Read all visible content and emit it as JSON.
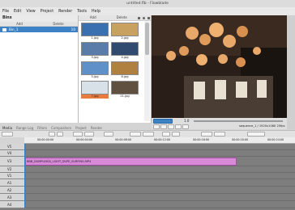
{
  "window": {
    "title": "untitled.flb - Flowblade"
  },
  "menu": [
    "File",
    "Edit",
    "View",
    "Project",
    "Render",
    "Tools",
    "Help"
  ],
  "bins": {
    "header": "Bins",
    "columns": [
      "Add",
      "Delete"
    ],
    "items": [
      {
        "name": "Bin_1",
        "count": "10"
      }
    ]
  },
  "media": {
    "columns": [
      "Add",
      "Delete"
    ],
    "thumbs": [
      {
        "caption": "1.jpg",
        "color": "#3a6fb0"
      },
      {
        "caption": "2.jpg",
        "color": "#c8a060"
      },
      {
        "caption": "3.jpg",
        "color": "#5a7ca8"
      },
      {
        "caption": "4.jpg",
        "color": "#304a70"
      },
      {
        "caption": "5.jpg",
        "color": "#6090c8"
      },
      {
        "caption": "6.jpg",
        "color": "#b08040"
      },
      {
        "caption": "7.jpg",
        "color": "#d8e0e8"
      },
      {
        "caption": "21.jpg",
        "color": "#605040"
      }
    ]
  },
  "tabs": [
    "Media",
    "Range Log",
    "Filters",
    "Compositors",
    "Project",
    "Render"
  ],
  "viewer": {
    "timecode": "00:00:00:00",
    "info": "sequence_1 / 1920x1080 25fps",
    "clip_label": "1.0"
  },
  "timeline": {
    "ruler_marks": [
      "00:00:00:00",
      "00:00:04:00",
      "00:00:08:00",
      "00:00:12:00",
      "00:00:16:00",
      "00:00:20:00",
      "00:00:24:00",
      "00:00:28:00"
    ],
    "tracks": [
      "V5",
      "V4",
      "V3",
      "V2",
      "V1",
      "A1",
      "A2",
      "A3",
      "A4"
    ],
    "clip_label": "BBB_DUMPLINGS_LIGHT_DUPE_SURFING.MP4",
    "clip_color": "#d88ad8"
  },
  "colors": {
    "accent": "#3d82c4",
    "selected": "#e87c3e"
  }
}
